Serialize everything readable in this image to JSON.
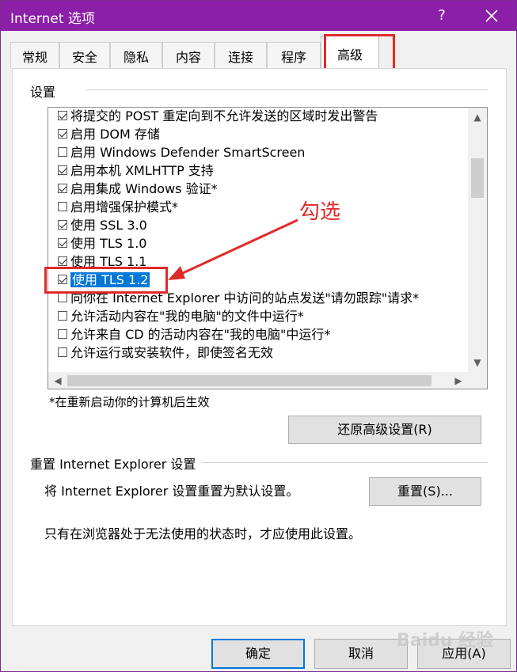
{
  "window": {
    "title": "Internet 选项",
    "help": "?"
  },
  "tabs": [
    {
      "label": "常规"
    },
    {
      "label": "安全"
    },
    {
      "label": "隐私"
    },
    {
      "label": "内容"
    },
    {
      "label": "连接"
    },
    {
      "label": "程序"
    },
    {
      "label": "高级"
    }
  ],
  "settings": {
    "group_label": "设置",
    "items": [
      {
        "label": "将提交的 POST 重定向到不允许发送的区域时发出警告",
        "checked": true
      },
      {
        "label": "启用 DOM 存储",
        "checked": true
      },
      {
        "label": "启用 Windows Defender SmartScreen",
        "checked": false
      },
      {
        "label": "启用本机 XMLHTTP 支持",
        "checked": true
      },
      {
        "label": "启用集成 Windows 验证*",
        "checked": true
      },
      {
        "label": "启用增强保护模式*",
        "checked": false
      },
      {
        "label": "使用 SSL 3.0",
        "checked": true
      },
      {
        "label": "使用 TLS 1.0",
        "checked": true
      },
      {
        "label": "使用 TLS 1.1",
        "checked": true
      },
      {
        "label": "使用 TLS 1.2",
        "checked": true,
        "selected": true
      },
      {
        "label": "向你在 Internet Explorer 中访问的站点发送\"请勿跟踪\"请求*",
        "checked": false
      },
      {
        "label": "允许活动内容在\"我的电脑\"的文件中运行*",
        "checked": false
      },
      {
        "label": "允许来自 CD 的活动内容在\"我的电脑\"中运行*",
        "checked": false
      },
      {
        "label": "允许运行或安装软件，即使签名无效",
        "checked": false
      }
    ],
    "restart_note": "*在重新启动你的计算机后生效",
    "restore_button": "还原高级设置(R)"
  },
  "annotation": {
    "label": "勾选"
  },
  "reset": {
    "group_label": "重置 Internet Explorer 设置",
    "description": "将 Internet Explorer 设置重置为默认设置。",
    "button": "重置(S)...",
    "note": "只有在浏览器处于无法使用的状态时，才应使用此设置。"
  },
  "footer": {
    "ok": "确定",
    "cancel": "取消",
    "apply": "应用(A)"
  },
  "watermark": {
    "text": "Baidu 经验"
  },
  "colors": {
    "titlebar": "#8b1fa8",
    "highlight": "#e02a2a",
    "selection": "#0078d7"
  }
}
